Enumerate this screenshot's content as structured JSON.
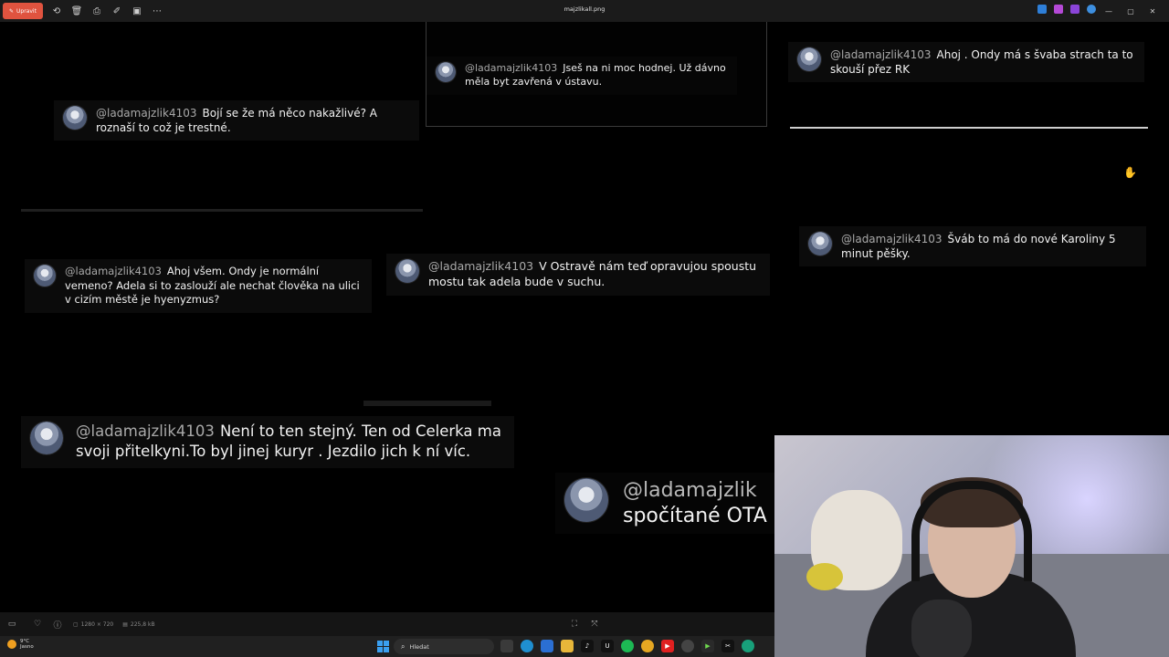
{
  "toolbar": {
    "edit_label": "Upravit",
    "title": "majzlikall.png",
    "tools": [
      "rotate-icon",
      "delete-icon",
      "print-icon",
      "edit-image-icon",
      "crop-icon",
      "more-icon"
    ]
  },
  "comments": [
    {
      "user": "@ladamajzlik4103",
      "text": "Bojí se že má něco nakažlivé? A roznaší to což je trestné."
    },
    {
      "user": "@ladamajzlik4103",
      "text": "Jseš na ni moc hodnej. Už dávno měla byt zavřená v ústavu."
    },
    {
      "user": "@ladamajzlik4103",
      "text": "Ahoj . Ondy má s švaba strach ta to skouší přez RK"
    },
    {
      "user": "@ladamajzlik4103",
      "text": "Šváb to má do nové Karoliny 5 minut pěšky."
    },
    {
      "user": "@ladamajzlik4103",
      "text": "Ahoj všem. Ondy je normální vemeno? Adela si to zaslouží ale nechat člověka na ulici v cizím městě je hyenyzmus?"
    },
    {
      "user": "@ladamajzlik4103",
      "text": "V Ostravě nám teď opravujou spoustu mostu tak adela bude v suchu."
    },
    {
      "user": "@ladamajzlik4103",
      "text": "Není to ten stejný. Ten od Celerka ma svoji přitelkyni.To byl jinej kuryr . Jezdilo jich k ní víc."
    },
    {
      "user": "@ladamajzlik",
      "text": "spočítané OTA"
    }
  ],
  "statusbar": {
    "dimensions": "1280 × 720",
    "filesize": "225,8 kB"
  },
  "taskbar": {
    "temperature": "9°C",
    "weather": "Jasno",
    "search_placeholder": "Hledat"
  },
  "colors": {
    "accent": "#e0533f",
    "background": "#000000"
  }
}
